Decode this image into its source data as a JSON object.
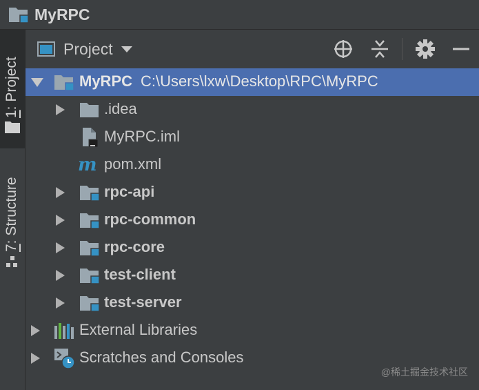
{
  "window": {
    "title": "MyRPC"
  },
  "side_strip": {
    "project_tab": {
      "number": "1",
      "label": ": Project"
    },
    "structure_tab": {
      "number": "7",
      "label": ": Structure"
    }
  },
  "tool_window": {
    "view_label": "Project",
    "buttons": [
      "locate-icon",
      "collapse-all-icon",
      "gear-icon",
      "minimize-icon"
    ]
  },
  "tree": {
    "root": {
      "name": "MyRPC",
      "path": "C:\\Users\\lxw\\Desktop\\RPC\\MyRPC"
    },
    "children": [
      {
        "name": ".idea"
      },
      {
        "name": "MyRPC.iml"
      },
      {
        "name": "pom.xml"
      },
      {
        "name": "rpc-api"
      },
      {
        "name": "rpc-common"
      },
      {
        "name": "rpc-core"
      },
      {
        "name": "test-client"
      },
      {
        "name": "test-server"
      }
    ],
    "external_libraries": "External Libraries",
    "scratches": "Scratches and Consoles"
  },
  "watermark": "@稀土掘金技术社区",
  "colors": {
    "background": "#3c3f41",
    "selection": "#4b6eaf",
    "module_badge": "#3592c4",
    "folder": "#9aa7b0"
  }
}
